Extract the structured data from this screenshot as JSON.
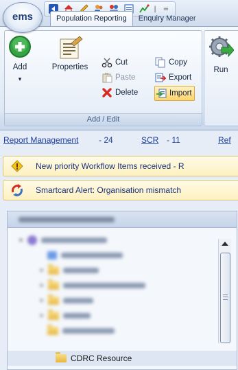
{
  "app": {
    "logo_text": "ems"
  },
  "quick_access": {
    "icons": [
      "back-icon",
      "home-icon",
      "edit-pencil-icon",
      "users-icon",
      "group-users-icon",
      "document-icon",
      "chart-icon",
      "customize-dropdown-icon"
    ],
    "overflow_glyph": "="
  },
  "tabs": [
    {
      "label": "Population Reporting",
      "active": true
    },
    {
      "label": "Enquiry Manager",
      "active": false
    }
  ],
  "ribbon": {
    "group_label": "Add / Edit",
    "add_label": "Add",
    "properties_label": "Properties",
    "cut_label": "Cut",
    "paste_label": "Paste",
    "delete_label": "Delete",
    "copy_label": "Copy",
    "export_label": "Export",
    "import_label": "Import",
    "run_label": "Run"
  },
  "status_links": {
    "report_management": {
      "label": "Report Management",
      "count": "- 24"
    },
    "scr": {
      "label": "SCR",
      "count": "- 11"
    },
    "ref": {
      "label": "Ref"
    }
  },
  "alerts": [
    {
      "text": "New priority Workflow Items received - R",
      "icon": "warning-diamond-icon"
    },
    {
      "text": "Smartcard Alert: Organisation mismatch",
      "icon": "smartcard-refresh-icon"
    }
  ],
  "tree": {
    "cdrc_label": "CDRC Resource"
  },
  "colors": {
    "link": "#1e3fa0",
    "alert_background": "#fdf1c0",
    "selected_button": "#ffd46b"
  }
}
